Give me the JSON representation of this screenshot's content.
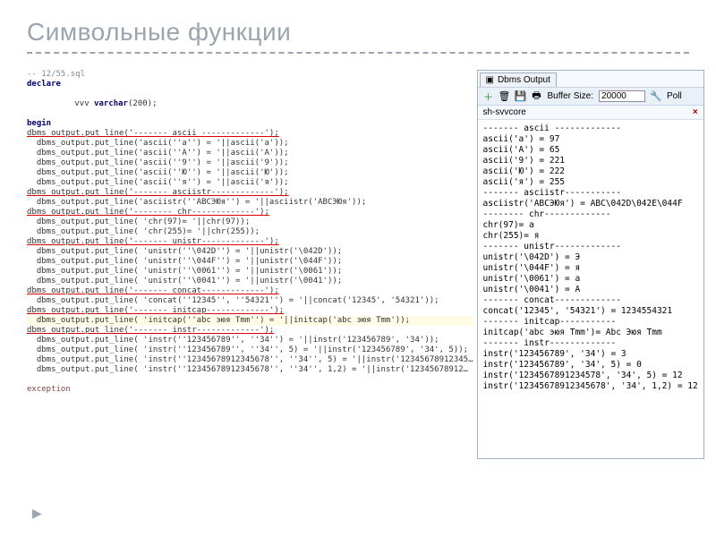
{
  "title": "Символьные функции",
  "code": {
    "comment": "-- 12/55.sql",
    "declare": "declare",
    "vvv": "vvv",
    "varchar": "varchar",
    "varchar_len": "200",
    "begin": "begin",
    "lines": [
      "dbms_output.put_line('------- ascii -------------');",
      "  dbms_output.put_line('ascii(''a'') = '||ascii('a'));",
      "  dbms_output.put_line('ascii(''A'') = '||ascii('A'));",
      "  dbms_output.put_line('ascii(''9'') = '||ascii('9'));",
      "  dbms_output.put_line('ascii(''Ю'') = '||ascii('Ю'));",
      "  dbms_output.put_line('ascii(''я'') = '||ascii('я'));",
      "dbms_output.put_line('------- asciistr-------------');",
      "  dbms_output.put_line('asciistr(''ABCЭЮя'') = '||asciistr('ABCЭЮя'));",
      "dbms_output.put_line('-------- chr-------------');",
      "  dbms_output.put_line( 'chr(97)= '||chr(97));",
      "  dbms_output.put_line( 'chr(255)= '||chr(255));",
      "dbms_output.put_line('------- unistr-------------');",
      "  dbms_output.put_line( 'unistr(''\\042D'') = '||unistr('\\042D'));",
      "  dbms_output.put_line( 'unistr(''\\044F'') = '||unistr('\\044F'));",
      "  dbms_output.put_line( 'unistr(''\\0061'') = '||unistr('\\0061'));",
      "  dbms_output.put_line( 'unistr(''\\0041'') = '||unistr('\\0041'));",
      "dbms_output.put_line('------- concat-------------');",
      "  dbms_output.put_line( 'concat(''12345'', ''54321'') = '||concat('12345', '54321'));",
      "dbms_output.put_line('------- initcap-------------');",
      "  dbms_output.put_line( 'initcap(''abc эюя Tmm'') = '||initcap('abc эюя Tmm'));",
      "dbms_output.put_line('------- instr-------------');",
      "  dbms_output.put_line( 'instr(''123456789'', ''34'') = '||instr('123456789', '34'));",
      "  dbms_output.put_line( 'instr(''123456789'', ''34'', 5) = '||instr('123456789', '34', 5));",
      "  dbms_output.put_line( 'instr(''12345678912345678'', ''34'', 5) = '||instr('12345678912345…",
      "  dbms_output.put_line( 'instr(''12345678912345678'', ''34'', 1,2) = '||instr('12345678912…"
    ],
    "exception": "exception"
  },
  "panel": {
    "tab": "Dbms Output",
    "buffer_label": "Buffer Size:",
    "buffer_value": "20000",
    "poll": "Poll",
    "db": "sh-svvcore",
    "icons": {
      "plus": "plus-icon",
      "save": "save-icon",
      "trash": "trash-icon",
      "print": "print-icon",
      "x": "close-icon"
    }
  },
  "output": [
    "------- ascii -------------",
    "ascii('a') = 97",
    "ascii('A') = 65",
    "ascii('9') = 221",
    "ascii('Ю') = 222",
    "ascii('я') = 255",
    "------- asciistr-----------",
    "asciistr('ABCЭЮя') = ABC\\042D\\042E\\044F",
    "-------- chr-------------",
    "chr(97)= a",
    "chr(255)= я",
    "------- unistr-------------",
    "unistr('\\042D') = Э",
    "unistr('\\044F') = я",
    "unistr('\\0061') = a",
    "unistr('\\0041') = A",
    "------- concat-------------",
    "concat('12345', '54321') = 1234554321",
    "------- initcap-----------",
    "initcap('abc эюя Tmm')= Abc Эюя Tmm",
    "------- instr-------------",
    "instr('123456789', '34') = 3",
    "instr('123456789', '34', 5) = 0",
    "instr('1234567891234578', '34', 5) = 12",
    "instr('12345678912345678', '34', 1,2) = 12"
  ]
}
